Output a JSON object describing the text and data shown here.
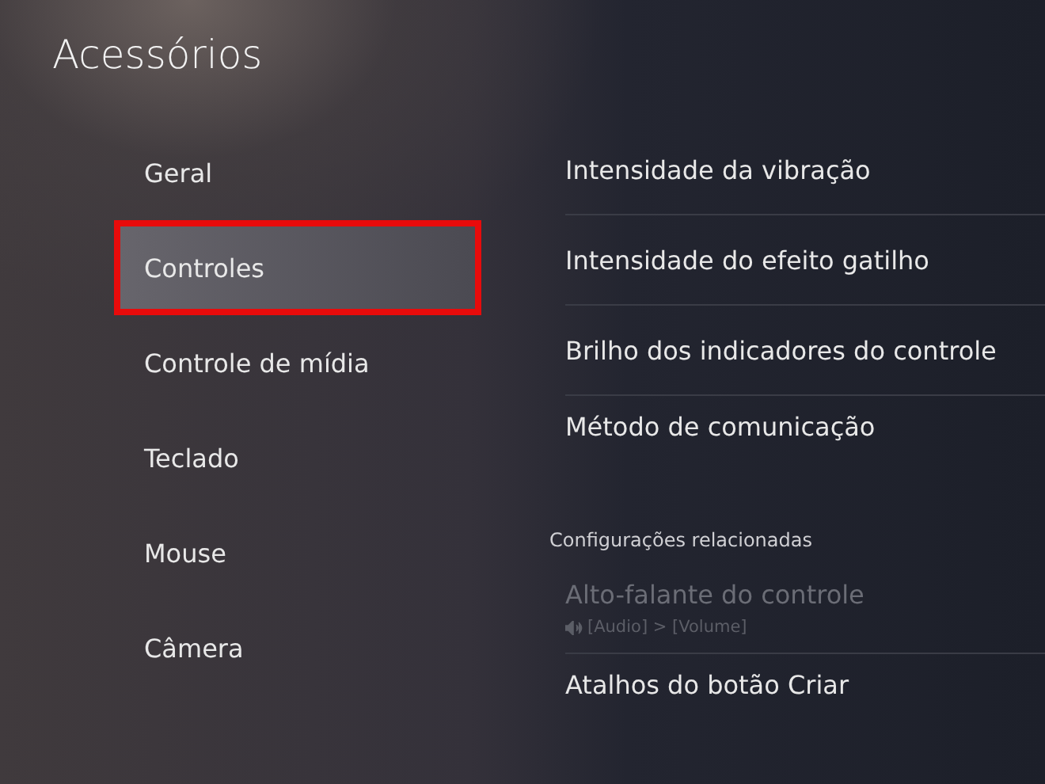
{
  "title": "Acessórios",
  "sidebar": {
    "items": [
      {
        "label": "Geral",
        "selected": false
      },
      {
        "label": "Controles",
        "selected": true
      },
      {
        "label": "Controle de mídia",
        "selected": false
      },
      {
        "label": "Teclado",
        "selected": false
      },
      {
        "label": "Mouse",
        "selected": false
      },
      {
        "label": "Câmera",
        "selected": false
      }
    ]
  },
  "settings": [
    {
      "label": "Intensidade da vibração"
    },
    {
      "label": "Intensidade do efeito gatilho"
    },
    {
      "label": "Brilho dos indicadores do controle"
    },
    {
      "label": "Método de comunicação"
    }
  ],
  "related": {
    "heading": "Configurações relacionadas",
    "items": [
      {
        "label": "Alto-falante do controle",
        "path": "[Audio] > [Volume]",
        "disabled": true
      },
      {
        "label": "Atalhos do botão Criar",
        "disabled": false
      }
    ]
  }
}
